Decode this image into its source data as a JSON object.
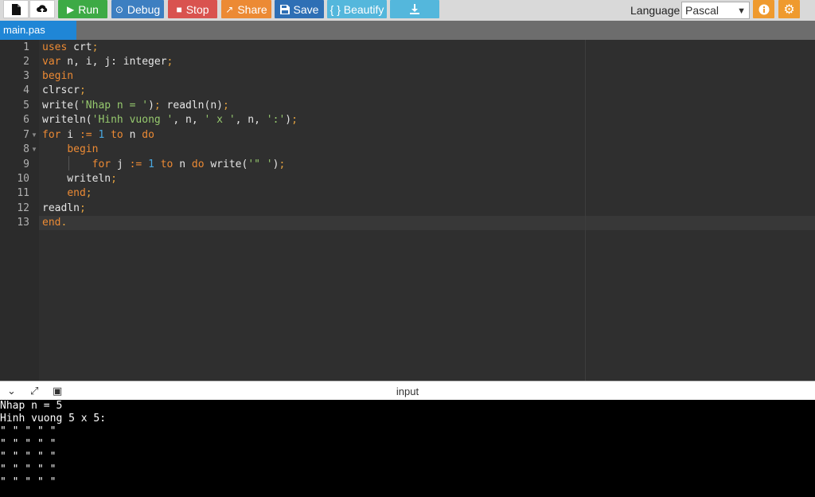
{
  "toolbar": {
    "new_icon": "file-icon",
    "upload_icon": "upload-icon",
    "run_label": "Run",
    "debug_label": "Debug",
    "stop_label": "Stop",
    "share_label": "Share",
    "save_label": "Save",
    "beautify_label": "{ } Beautify",
    "download_icon": "download-icon",
    "info_icon": "info-icon",
    "settings_icon": "gear-icon",
    "language_label": "Language",
    "language_value": "Pascal"
  },
  "tabs": [
    {
      "label": "main.pas",
      "active": true
    }
  ],
  "editor": {
    "line_numbers": [
      "1",
      "2",
      "3",
      "4",
      "5",
      "6",
      "7",
      "8",
      "9",
      "10",
      "11",
      "12",
      "13"
    ]
  },
  "console": {
    "title": "input",
    "output_lines": [
      "Nhap n = 5",
      "Hinh vuong 5 x 5:",
      "\" \" \" \" \"",
      "\" \" \" \" \"",
      "\" \" \" \" \"",
      "\" \" \" \" \"",
      "\" \" \" \" \""
    ]
  },
  "colors": {
    "run": "#3daa45",
    "debug": "#3d7fc1",
    "stop": "#d9534f",
    "share": "#ec8a34",
    "save": "#2e6fb5",
    "beautify": "#54b7dc",
    "tab_active": "#1f86d6",
    "keyword": "#ec8a34",
    "string": "#96c96e",
    "number": "#4aa8e0"
  }
}
